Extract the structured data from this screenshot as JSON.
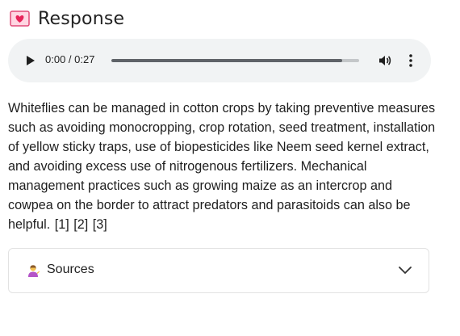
{
  "header": {
    "title": "Response",
    "icon": "heart-letter-icon"
  },
  "audio": {
    "time": "0:00 / 0:27",
    "progress_fraction": 0.93,
    "play_icon": "play-icon",
    "volume_icon": "volume-icon",
    "more_icon": "more-vert-icon"
  },
  "answer": {
    "text": "Whiteflies can be managed in cotton crops by taking preventive measures such as avoiding monocropping, crop rotation, seed treatment, installation of yellow sticky traps, use of biopesticides like Neem seed kernel extract, and avoiding excess use of nitrogenous fertilizers. Mechanical management practices such as growing maize as an intercrop and cowpea on the border to attract predators and parasitoids can also be helpful.",
    "citations": [
      "[1]",
      "[2]",
      "[3]"
    ]
  },
  "sources": {
    "label": "Sources",
    "icon": "person-tipping-hand-icon",
    "chevron_icon": "chevron-down-icon"
  },
  "colors": {
    "player_bg": "#f1f3f4",
    "progress_fill": "#5f6368",
    "progress_track": "#c4c7c9",
    "border": "#e2e2e2"
  }
}
